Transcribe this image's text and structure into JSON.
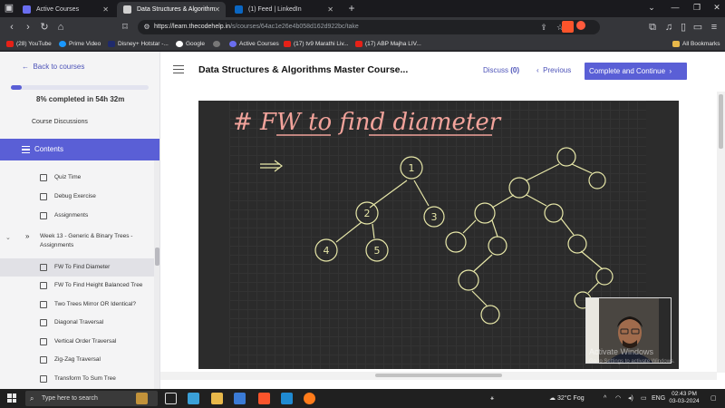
{
  "browser": {
    "tabs": [
      {
        "title": "Active Courses",
        "active": false
      },
      {
        "title": "Data Structures & Algorithm",
        "active": true
      },
      {
        "title": "(1) Feed | LinkedIn",
        "active": false
      }
    ],
    "new_tab": "+",
    "url_host": "https://learn.thecodehelp.in",
    "url_path": "/s/courses/64ac1e26e4b058d162d922bc/take",
    "bookmarks": [
      {
        "label": "(28) YouTube",
        "color": "#e62117"
      },
      {
        "label": "Prime Video",
        "color": "#1a98ff"
      },
      {
        "label": "Disney+ Hotstar -...",
        "color": "#1f2a6b"
      },
      {
        "label": "Google",
        "color": "#ffffff"
      },
      {
        "label": "",
        "color": "#777777"
      },
      {
        "label": "Active Courses",
        "color": "#6a6ef0"
      },
      {
        "label": "(17) tv9 Marathi Liv...",
        "color": "#e62117"
      },
      {
        "label": "(17) ABP Majha LIV...",
        "color": "#e62117"
      }
    ],
    "all_bookmarks": "All Bookmarks"
  },
  "sidebar": {
    "back_label": "Back to courses",
    "progress_percent": 8,
    "progress_text": "8% completed in 54h 32m",
    "discussions": "Course Discussions",
    "contents": "Contents",
    "items": [
      {
        "label": "Quiz Time",
        "icon": "list-icon",
        "active": false
      },
      {
        "label": "Debug Exercise",
        "icon": "list-icon",
        "active": false
      },
      {
        "label": "Assignments",
        "icon": "list-icon",
        "active": false
      }
    ],
    "week": {
      "line1": "Week 13 - Generic & Binary Trees -",
      "line2": "Assignments"
    },
    "lessons": [
      {
        "label": "FW To Find Diameter",
        "active": true
      },
      {
        "label": "FW To Find Height Balanced Tree",
        "active": false
      },
      {
        "label": "Two Trees Mirror OR Identical?",
        "active": false
      },
      {
        "label": "Diagonal Traversal",
        "active": false
      },
      {
        "label": "Vertical Order Traversal",
        "active": false
      },
      {
        "label": "Zig-Zag Traversal",
        "active": false
      },
      {
        "label": "Transform To Sum Tree",
        "active": false
      }
    ]
  },
  "main": {
    "title": "Data Structures & Algorithms Master Course...",
    "discuss_label": "Discuss",
    "discuss_count": "(0)",
    "previous_label": "Previous",
    "complete_label": "Complete and Continue",
    "board_heading": "# FW to find diameter",
    "node_labels": [
      "1",
      "2",
      "3",
      "4",
      "5"
    ],
    "watermark_line1": "Activate Windows",
    "watermark_line2": "Go to Settings to activate Windows."
  },
  "taskbar": {
    "search_placeholder": "Type here to search",
    "temperature": "32°C",
    "weather": "Fog",
    "language": "ENG",
    "time": "02:43 PM",
    "date": "03-03-2024"
  }
}
